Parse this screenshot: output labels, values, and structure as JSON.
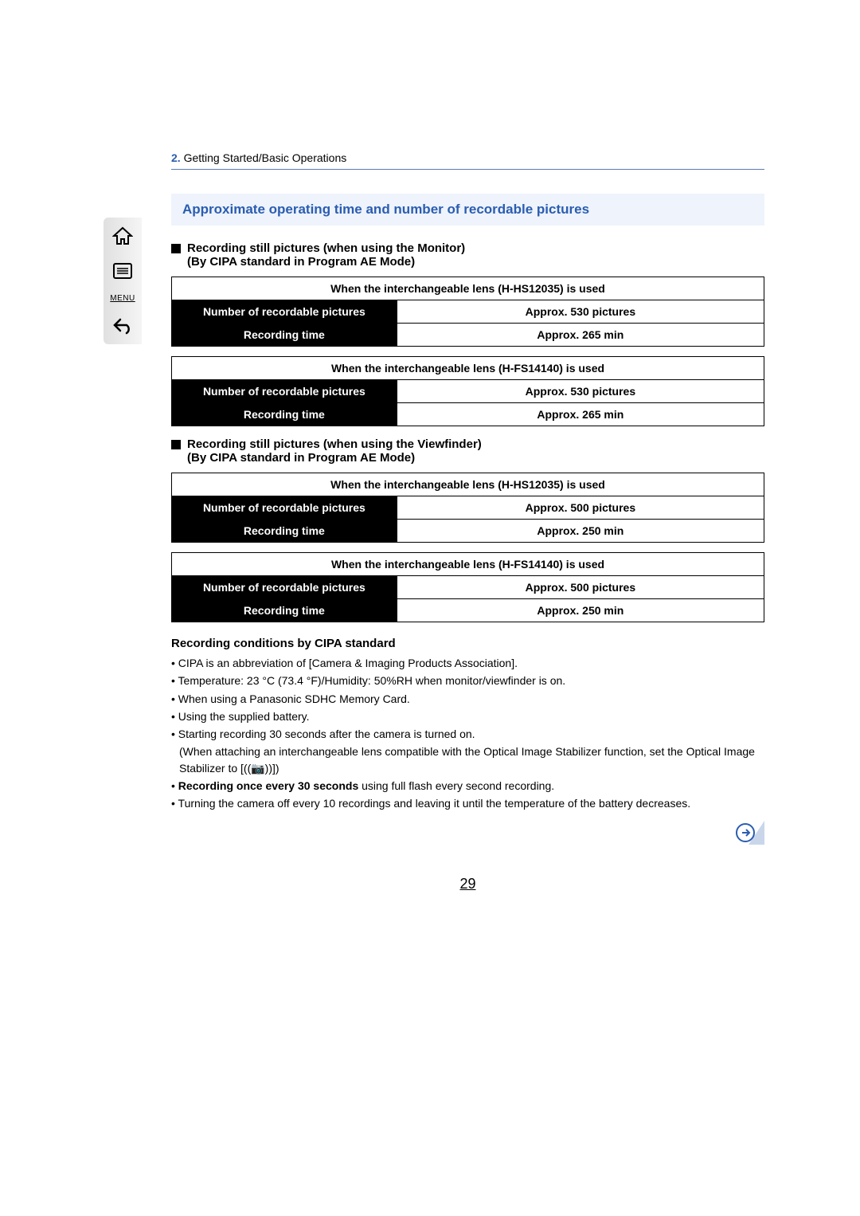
{
  "breadcrumb": {
    "number": "2.",
    "text": "Getting Started/Basic Operations"
  },
  "sidebar": {
    "home": "home-icon",
    "toc": "toc-icon",
    "menu_label": "MENU",
    "back": "back-icon"
  },
  "section_title": "Approximate operating time and number of recordable pictures",
  "sub1": {
    "line1": "Recording still pictures (when using the Monitor)",
    "line2": "(By CIPA standard in Program AE Mode)"
  },
  "sub2": {
    "line1": "Recording still pictures (when using the Viewfinder)",
    "line2": "(By CIPA standard in Program AE Mode)"
  },
  "labels": {
    "num_pictures": "Number of recordable pictures",
    "rec_time": "Recording time"
  },
  "tables_monitor": [
    {
      "header": "When the interchangeable lens (H-HS12035) is used",
      "pictures": "Approx. 530 pictures",
      "time": "Approx. 265 min"
    },
    {
      "header": "When the interchangeable lens (H-FS14140) is used",
      "pictures": "Approx. 530 pictures",
      "time": "Approx. 265 min"
    }
  ],
  "tables_viewfinder": [
    {
      "header": "When the interchangeable lens (H-HS12035) is used",
      "pictures": "Approx. 500 pictures",
      "time": "Approx. 250 min"
    },
    {
      "header": "When the interchangeable lens (H-FS14140) is used",
      "pictures": "Approx. 500 pictures",
      "time": "Approx. 250 min"
    }
  ],
  "conditions": {
    "heading": "Recording conditions by CIPA standard",
    "items": [
      "CIPA is an abbreviation of [Camera & Imaging Products Association].",
      "Temperature:  23 °C (73.4 °F)/Humidity:  50%RH when monitor/viewfinder is on.",
      "When using a Panasonic SDHC Memory Card.",
      "Using the supplied battery.",
      "Starting recording 30 seconds after the camera is turned on.",
      "(When attaching an interchangeable lens compatible with the Optical Image Stabilizer function, set the Optical Image Stabilizer to [((📷))])",
      "using full flash every second recording.",
      "Turning the camera off every 10 recordings and leaving it until the temperature of the battery decreases."
    ],
    "bold_prefix": "Recording once every 30 seconds"
  },
  "page_number": "29"
}
